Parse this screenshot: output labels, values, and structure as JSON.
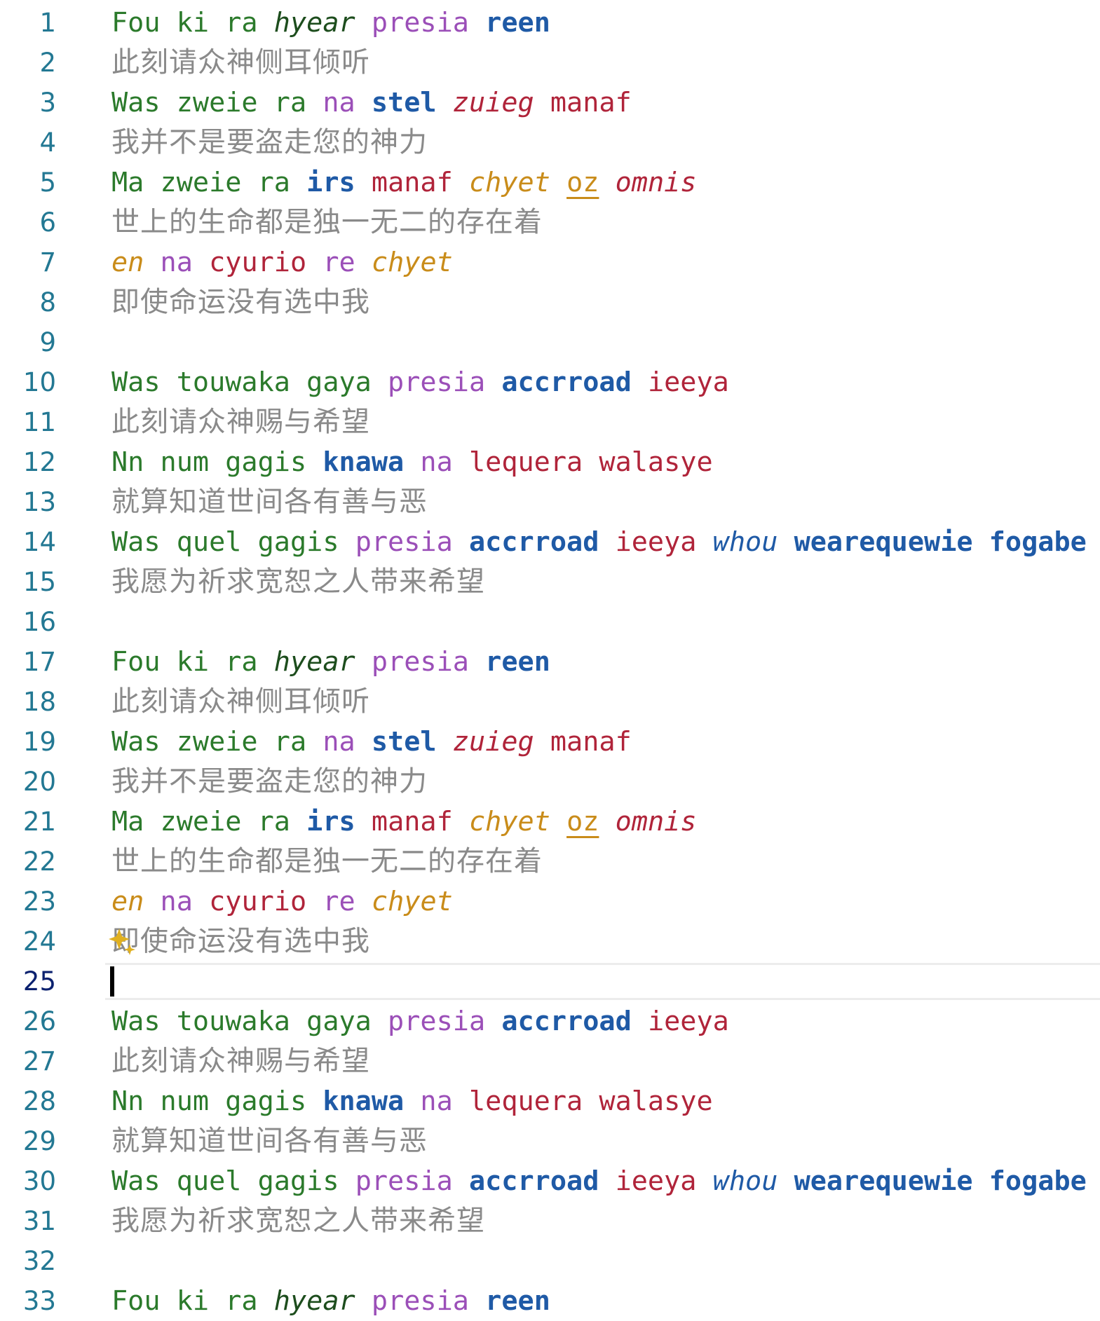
{
  "editor": {
    "current_line": "25",
    "lines": [
      {
        "n": "1",
        "tokens": [
          [
            "Fou ki ra ",
            "green"
          ],
          [
            "hyear",
            "italic-green"
          ],
          [
            " ",
            "green"
          ],
          [
            "presia",
            "purple"
          ],
          [
            " ",
            "green"
          ],
          [
            "reen",
            "blue"
          ]
        ]
      },
      {
        "n": "2",
        "zh": "此刻请众神侧耳倾听"
      },
      {
        "n": "3",
        "tokens": [
          [
            "Was zweie ra ",
            "green"
          ],
          [
            "na",
            "purple"
          ],
          [
            " ",
            "green"
          ],
          [
            "stel",
            "blue"
          ],
          [
            " ",
            "green"
          ],
          [
            "zuieg",
            "italic-red"
          ],
          [
            " ",
            "green"
          ],
          [
            "manaf",
            "red"
          ]
        ]
      },
      {
        "n": "4",
        "zh": "我并不是要盗走您的神力"
      },
      {
        "n": "5",
        "tokens": [
          [
            "Ma zweie ra ",
            "green"
          ],
          [
            "irs",
            "blue"
          ],
          [
            " ",
            "green"
          ],
          [
            "manaf",
            "red"
          ],
          [
            " ",
            "green"
          ],
          [
            "chyet",
            "orange"
          ],
          [
            " ",
            "green"
          ],
          [
            "oz",
            "underline"
          ],
          [
            " ",
            "green"
          ],
          [
            "omnis",
            "italic-red"
          ]
        ]
      },
      {
        "n": "6",
        "zh": "世上的生命都是独一无二的存在着"
      },
      {
        "n": "7",
        "tokens": [
          [
            "en",
            "orange"
          ],
          [
            " ",
            "green"
          ],
          [
            "na",
            "purple"
          ],
          [
            " ",
            "green"
          ],
          [
            "cyurio",
            "red"
          ],
          [
            " ",
            "green"
          ],
          [
            "re",
            "purple"
          ],
          [
            " ",
            "green"
          ],
          [
            "chyet",
            "orange"
          ]
        ]
      },
      {
        "n": "8",
        "zh": "即使命运没有选中我"
      },
      {
        "n": "9",
        "tokens": []
      },
      {
        "n": "10",
        "tokens": [
          [
            "Was touwaka gaya ",
            "green"
          ],
          [
            "presia",
            "purple"
          ],
          [
            " ",
            "green"
          ],
          [
            "accrroad",
            "blue"
          ],
          [
            " ",
            "green"
          ],
          [
            "ieeya",
            "red"
          ]
        ]
      },
      {
        "n": "11",
        "zh": "此刻请众神赐与希望"
      },
      {
        "n": "12",
        "tokens": [
          [
            "Nn num gagis ",
            "green"
          ],
          [
            "knawa",
            "blue"
          ],
          [
            " ",
            "green"
          ],
          [
            "na",
            "purple"
          ],
          [
            " ",
            "green"
          ],
          [
            "lequera walasye",
            "red"
          ]
        ]
      },
      {
        "n": "13",
        "zh": "就算知道世间各有善与恶"
      },
      {
        "n": "14",
        "tokens": [
          [
            "Was quel gagis ",
            "green"
          ],
          [
            "presia",
            "purple"
          ],
          [
            " ",
            "green"
          ],
          [
            "accrroad",
            "blue"
          ],
          [
            " ",
            "green"
          ],
          [
            "ieeya",
            "red"
          ],
          [
            " ",
            "green"
          ],
          [
            "whou",
            "italic-blue"
          ],
          [
            " ",
            "green"
          ],
          [
            "wearequewie",
            "blue"
          ],
          [
            " ",
            "green"
          ],
          [
            "fogabe",
            "blue"
          ]
        ]
      },
      {
        "n": "15",
        "zh": "我愿为祈求宽恕之人带来希望"
      },
      {
        "n": "16",
        "tokens": []
      },
      {
        "n": "17",
        "tokens": [
          [
            "Fou ki ra ",
            "green"
          ],
          [
            "hyear",
            "italic-green"
          ],
          [
            " ",
            "green"
          ],
          [
            "presia",
            "purple"
          ],
          [
            " ",
            "green"
          ],
          [
            "reen",
            "blue"
          ]
        ]
      },
      {
        "n": "18",
        "zh": "此刻请众神侧耳倾听"
      },
      {
        "n": "19",
        "tokens": [
          [
            "Was zweie ra ",
            "green"
          ],
          [
            "na",
            "purple"
          ],
          [
            " ",
            "green"
          ],
          [
            "stel",
            "blue"
          ],
          [
            " ",
            "green"
          ],
          [
            "zuieg",
            "italic-red"
          ],
          [
            " ",
            "green"
          ],
          [
            "manaf",
            "red"
          ]
        ]
      },
      {
        "n": "20",
        "zh": "我并不是要盗走您的神力"
      },
      {
        "n": "21",
        "tokens": [
          [
            "Ma zweie ra ",
            "green"
          ],
          [
            "irs",
            "blue"
          ],
          [
            " ",
            "green"
          ],
          [
            "manaf",
            "red"
          ],
          [
            " ",
            "green"
          ],
          [
            "chyet",
            "orange"
          ],
          [
            " ",
            "green"
          ],
          [
            "oz",
            "underline"
          ],
          [
            " ",
            "green"
          ],
          [
            "omnis",
            "italic-red"
          ]
        ]
      },
      {
        "n": "22",
        "zh": "世上的生命都是独一无二的存在着"
      },
      {
        "n": "23",
        "tokens": [
          [
            "en",
            "orange"
          ],
          [
            " ",
            "green"
          ],
          [
            "na",
            "purple"
          ],
          [
            " ",
            "green"
          ],
          [
            "cyurio",
            "red"
          ],
          [
            " ",
            "green"
          ],
          [
            "re",
            "purple"
          ],
          [
            " ",
            "green"
          ],
          [
            "chyet",
            "orange"
          ]
        ]
      },
      {
        "n": "24",
        "zh": "即使命运没有选中我",
        "sparkle": true
      },
      {
        "n": "25",
        "tokens": [],
        "cursor": true
      },
      {
        "n": "26",
        "tokens": [
          [
            "Was touwaka gaya ",
            "green"
          ],
          [
            "presia",
            "purple"
          ],
          [
            " ",
            "green"
          ],
          [
            "accrroad",
            "blue"
          ],
          [
            " ",
            "green"
          ],
          [
            "ieeya",
            "red"
          ]
        ]
      },
      {
        "n": "27",
        "zh": "此刻请众神赐与希望"
      },
      {
        "n": "28",
        "tokens": [
          [
            "Nn num gagis ",
            "green"
          ],
          [
            "knawa",
            "blue"
          ],
          [
            " ",
            "green"
          ],
          [
            "na",
            "purple"
          ],
          [
            " ",
            "green"
          ],
          [
            "lequera walasye",
            "red"
          ]
        ]
      },
      {
        "n": "29",
        "zh": "就算知道世间各有善与恶"
      },
      {
        "n": "30",
        "tokens": [
          [
            "Was quel gagis ",
            "green"
          ],
          [
            "presia",
            "purple"
          ],
          [
            " ",
            "green"
          ],
          [
            "accrroad",
            "blue"
          ],
          [
            " ",
            "green"
          ],
          [
            "ieeya",
            "red"
          ],
          [
            " ",
            "green"
          ],
          [
            "whou",
            "italic-blue"
          ],
          [
            " ",
            "green"
          ],
          [
            "wearequewie",
            "blue"
          ],
          [
            " ",
            "green"
          ],
          [
            "fogabe",
            "blue"
          ]
        ]
      },
      {
        "n": "31",
        "zh": "我愿为祈求宽恕之人带来希望"
      },
      {
        "n": "32",
        "tokens": []
      },
      {
        "n": "33",
        "tokens": [
          [
            "Fou ki ra ",
            "green"
          ],
          [
            "hyear",
            "italic-green"
          ],
          [
            " ",
            "green"
          ],
          [
            "presia",
            "purple"
          ],
          [
            " ",
            "green"
          ],
          [
            "reen",
            "blue"
          ]
        ]
      }
    ]
  },
  "icons": {
    "sparkle": "sparkle-icon"
  },
  "colors": {
    "line_number": "#237893",
    "green": "#2b7a2b",
    "purple": "#9b4fb8",
    "blue": "#1f5aa6",
    "red": "#b0243a",
    "orange": "#c98c1a",
    "chinese_text": "#8a8a8a",
    "sparkle": "#e0b020"
  }
}
